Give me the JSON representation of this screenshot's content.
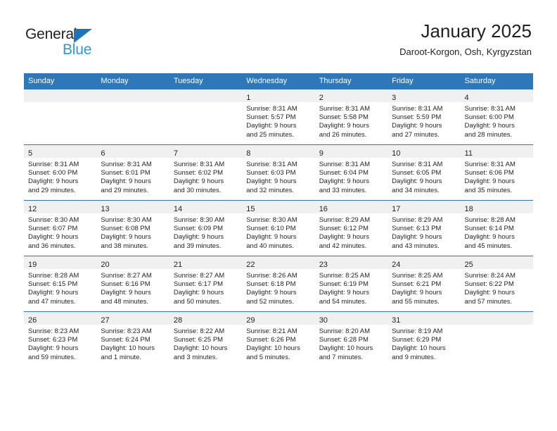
{
  "brand": {
    "logo_text_1": "General",
    "logo_text_2": "Blue",
    "logo_triangle_icon": "triangle-icon",
    "accent_color": "#2e77b8",
    "logo_blue": "#2e97d4"
  },
  "header": {
    "title": "January 2025",
    "subtitle": "Daroot-Korgon, Osh, Kyrgyzstan"
  },
  "calendar": {
    "weekday_headers": [
      "Sunday",
      "Monday",
      "Tuesday",
      "Wednesday",
      "Thursday",
      "Friday",
      "Saturday"
    ],
    "header_bg": "#2e77b8",
    "daynum_bg": "#f0f0f0",
    "weeks": [
      [
        {
          "day": "",
          "sunrise": "",
          "sunset": "",
          "daylight_line1": "",
          "daylight_line2": ""
        },
        {
          "day": "",
          "sunrise": "",
          "sunset": "",
          "daylight_line1": "",
          "daylight_line2": ""
        },
        {
          "day": "",
          "sunrise": "",
          "sunset": "",
          "daylight_line1": "",
          "daylight_line2": ""
        },
        {
          "day": "1",
          "sunrise": "Sunrise: 8:31 AM",
          "sunset": "Sunset: 5:57 PM",
          "daylight_line1": "Daylight: 9 hours",
          "daylight_line2": "and 25 minutes."
        },
        {
          "day": "2",
          "sunrise": "Sunrise: 8:31 AM",
          "sunset": "Sunset: 5:58 PM",
          "daylight_line1": "Daylight: 9 hours",
          "daylight_line2": "and 26 minutes."
        },
        {
          "day": "3",
          "sunrise": "Sunrise: 8:31 AM",
          "sunset": "Sunset: 5:59 PM",
          "daylight_line1": "Daylight: 9 hours",
          "daylight_line2": "and 27 minutes."
        },
        {
          "day": "4",
          "sunrise": "Sunrise: 8:31 AM",
          "sunset": "Sunset: 6:00 PM",
          "daylight_line1": "Daylight: 9 hours",
          "daylight_line2": "and 28 minutes."
        }
      ],
      [
        {
          "day": "5",
          "sunrise": "Sunrise: 8:31 AM",
          "sunset": "Sunset: 6:00 PM",
          "daylight_line1": "Daylight: 9 hours",
          "daylight_line2": "and 29 minutes."
        },
        {
          "day": "6",
          "sunrise": "Sunrise: 8:31 AM",
          "sunset": "Sunset: 6:01 PM",
          "daylight_line1": "Daylight: 9 hours",
          "daylight_line2": "and 29 minutes."
        },
        {
          "day": "7",
          "sunrise": "Sunrise: 8:31 AM",
          "sunset": "Sunset: 6:02 PM",
          "daylight_line1": "Daylight: 9 hours",
          "daylight_line2": "and 30 minutes."
        },
        {
          "day": "8",
          "sunrise": "Sunrise: 8:31 AM",
          "sunset": "Sunset: 6:03 PM",
          "daylight_line1": "Daylight: 9 hours",
          "daylight_line2": "and 32 minutes."
        },
        {
          "day": "9",
          "sunrise": "Sunrise: 8:31 AM",
          "sunset": "Sunset: 6:04 PM",
          "daylight_line1": "Daylight: 9 hours",
          "daylight_line2": "and 33 minutes."
        },
        {
          "day": "10",
          "sunrise": "Sunrise: 8:31 AM",
          "sunset": "Sunset: 6:05 PM",
          "daylight_line1": "Daylight: 9 hours",
          "daylight_line2": "and 34 minutes."
        },
        {
          "day": "11",
          "sunrise": "Sunrise: 8:31 AM",
          "sunset": "Sunset: 6:06 PM",
          "daylight_line1": "Daylight: 9 hours",
          "daylight_line2": "and 35 minutes."
        }
      ],
      [
        {
          "day": "12",
          "sunrise": "Sunrise: 8:30 AM",
          "sunset": "Sunset: 6:07 PM",
          "daylight_line1": "Daylight: 9 hours",
          "daylight_line2": "and 36 minutes."
        },
        {
          "day": "13",
          "sunrise": "Sunrise: 8:30 AM",
          "sunset": "Sunset: 6:08 PM",
          "daylight_line1": "Daylight: 9 hours",
          "daylight_line2": "and 38 minutes."
        },
        {
          "day": "14",
          "sunrise": "Sunrise: 8:30 AM",
          "sunset": "Sunset: 6:09 PM",
          "daylight_line1": "Daylight: 9 hours",
          "daylight_line2": "and 39 minutes."
        },
        {
          "day": "15",
          "sunrise": "Sunrise: 8:30 AM",
          "sunset": "Sunset: 6:10 PM",
          "daylight_line1": "Daylight: 9 hours",
          "daylight_line2": "and 40 minutes."
        },
        {
          "day": "16",
          "sunrise": "Sunrise: 8:29 AM",
          "sunset": "Sunset: 6:12 PM",
          "daylight_line1": "Daylight: 9 hours",
          "daylight_line2": "and 42 minutes."
        },
        {
          "day": "17",
          "sunrise": "Sunrise: 8:29 AM",
          "sunset": "Sunset: 6:13 PM",
          "daylight_line1": "Daylight: 9 hours",
          "daylight_line2": "and 43 minutes."
        },
        {
          "day": "18",
          "sunrise": "Sunrise: 8:28 AM",
          "sunset": "Sunset: 6:14 PM",
          "daylight_line1": "Daylight: 9 hours",
          "daylight_line2": "and 45 minutes."
        }
      ],
      [
        {
          "day": "19",
          "sunrise": "Sunrise: 8:28 AM",
          "sunset": "Sunset: 6:15 PM",
          "daylight_line1": "Daylight: 9 hours",
          "daylight_line2": "and 47 minutes."
        },
        {
          "day": "20",
          "sunrise": "Sunrise: 8:27 AM",
          "sunset": "Sunset: 6:16 PM",
          "daylight_line1": "Daylight: 9 hours",
          "daylight_line2": "and 48 minutes."
        },
        {
          "day": "21",
          "sunrise": "Sunrise: 8:27 AM",
          "sunset": "Sunset: 6:17 PM",
          "daylight_line1": "Daylight: 9 hours",
          "daylight_line2": "and 50 minutes."
        },
        {
          "day": "22",
          "sunrise": "Sunrise: 8:26 AM",
          "sunset": "Sunset: 6:18 PM",
          "daylight_line1": "Daylight: 9 hours",
          "daylight_line2": "and 52 minutes."
        },
        {
          "day": "23",
          "sunrise": "Sunrise: 8:25 AM",
          "sunset": "Sunset: 6:19 PM",
          "daylight_line1": "Daylight: 9 hours",
          "daylight_line2": "and 54 minutes."
        },
        {
          "day": "24",
          "sunrise": "Sunrise: 8:25 AM",
          "sunset": "Sunset: 6:21 PM",
          "daylight_line1": "Daylight: 9 hours",
          "daylight_line2": "and 55 minutes."
        },
        {
          "day": "25",
          "sunrise": "Sunrise: 8:24 AM",
          "sunset": "Sunset: 6:22 PM",
          "daylight_line1": "Daylight: 9 hours",
          "daylight_line2": "and 57 minutes."
        }
      ],
      [
        {
          "day": "26",
          "sunrise": "Sunrise: 8:23 AM",
          "sunset": "Sunset: 6:23 PM",
          "daylight_line1": "Daylight: 9 hours",
          "daylight_line2": "and 59 minutes."
        },
        {
          "day": "27",
          "sunrise": "Sunrise: 8:23 AM",
          "sunset": "Sunset: 6:24 PM",
          "daylight_line1": "Daylight: 10 hours",
          "daylight_line2": "and 1 minute."
        },
        {
          "day": "28",
          "sunrise": "Sunrise: 8:22 AM",
          "sunset": "Sunset: 6:25 PM",
          "daylight_line1": "Daylight: 10 hours",
          "daylight_line2": "and 3 minutes."
        },
        {
          "day": "29",
          "sunrise": "Sunrise: 8:21 AM",
          "sunset": "Sunset: 6:26 PM",
          "daylight_line1": "Daylight: 10 hours",
          "daylight_line2": "and 5 minutes."
        },
        {
          "day": "30",
          "sunrise": "Sunrise: 8:20 AM",
          "sunset": "Sunset: 6:28 PM",
          "daylight_line1": "Daylight: 10 hours",
          "daylight_line2": "and 7 minutes."
        },
        {
          "day": "31",
          "sunrise": "Sunrise: 8:19 AM",
          "sunset": "Sunset: 6:29 PM",
          "daylight_line1": "Daylight: 10 hours",
          "daylight_line2": "and 9 minutes."
        },
        {
          "day": "",
          "sunrise": "",
          "sunset": "",
          "daylight_line1": "",
          "daylight_line2": ""
        }
      ]
    ]
  }
}
